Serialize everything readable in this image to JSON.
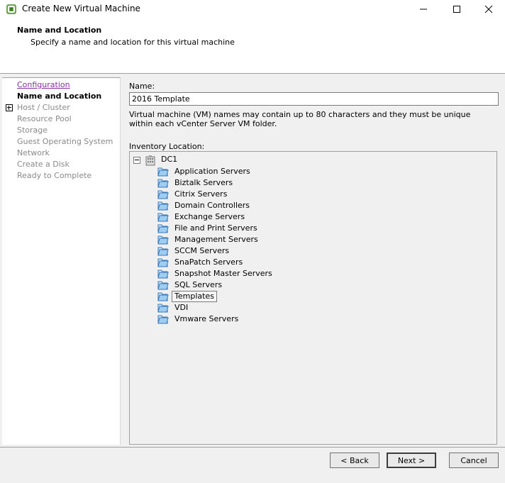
{
  "window": {
    "title": "Create New Virtual Machine",
    "controls": {
      "minimize": "minimize-icon",
      "maximize": "maximize-icon",
      "close": "close-icon"
    }
  },
  "header": {
    "title": "Name and Location",
    "subtitle": "Specify a name and location for this virtual machine"
  },
  "steps": [
    {
      "label": "Configuration",
      "state": "link"
    },
    {
      "label": "Name and Location",
      "state": "current"
    },
    {
      "label": "Host / Cluster",
      "state": "disabled"
    },
    {
      "label": "Resource Pool",
      "state": "disabled"
    },
    {
      "label": "Storage",
      "state": "disabled"
    },
    {
      "label": "Guest Operating System",
      "state": "disabled"
    },
    {
      "label": "Network",
      "state": "disabled"
    },
    {
      "label": "Create a Disk",
      "state": "disabled"
    },
    {
      "label": "Ready to Complete",
      "state": "disabled"
    }
  ],
  "form": {
    "name_label": "Name:",
    "name_value": "2016 Template",
    "help_text": "Virtual machine (VM) names may contain up to 80 characters and they must be unique within each vCenter Server VM folder.",
    "inventory_label": "Inventory Location:"
  },
  "tree": {
    "root": "DC1",
    "folders": [
      "Application Servers",
      "Biztalk Servers",
      "Citrix Servers",
      "Domain Controllers",
      "Exchange Servers",
      "File and Print Servers",
      "Management Servers",
      "SCCM Servers",
      "SnaPatch Servers",
      "Snapshot Master Servers",
      "SQL Servers",
      "Templates",
      "VDI",
      "Vmware Servers"
    ],
    "selected": "Templates"
  },
  "buttons": {
    "back": "< Back",
    "next": "Next >",
    "cancel": "Cancel"
  }
}
